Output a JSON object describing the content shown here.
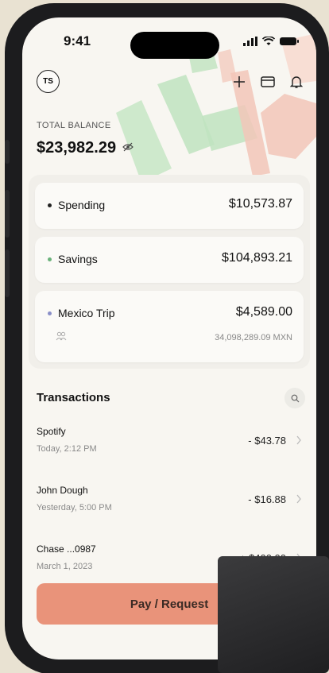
{
  "status_bar": {
    "time": "9:41"
  },
  "header": {
    "avatar_initials": "TS"
  },
  "balance": {
    "label": "TOTAL BALANCE",
    "amount": "$23,982.29"
  },
  "accounts": [
    {
      "name": "Spending",
      "amount": "$10,573.87",
      "dot_color": "#222222"
    },
    {
      "name": "Savings",
      "amount": "$104,893.21",
      "dot_color": "#6ab27a"
    },
    {
      "name": "Mexico Trip",
      "amount": "$4,589.00",
      "sub_amount": "34,098,289.09 MXN",
      "dot_color": "#8a8fc8"
    }
  ],
  "transactions": {
    "title": "Transactions",
    "items": [
      {
        "name": "Spotify",
        "date": "Today, 2:12 PM",
        "amount": "- $43.78"
      },
      {
        "name": "John Dough",
        "date": "Yesterday, 5:00 PM",
        "amount": "- $16.88"
      },
      {
        "name": "Chase ...0987",
        "date": "March 1, 2023",
        "amount": "+ $400.00"
      }
    ]
  },
  "actions": {
    "pay_request_label": "Pay / Request"
  },
  "colors": {
    "accent": "#e9937a",
    "background": "#f8f6f1"
  }
}
